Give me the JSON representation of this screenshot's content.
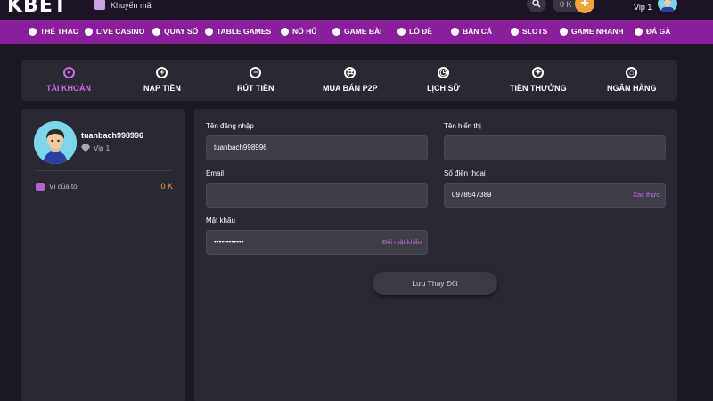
{
  "header": {
    "logo": "KBET",
    "promo_label": "Khuyến mãi",
    "balance": "0 K",
    "plus_label": "+",
    "vip_label": "Vip 1"
  },
  "categories": [
    {
      "label": "THỂ THAO",
      "icon": "soccer-ball-icon"
    },
    {
      "label": "LIVE CASINO",
      "icon": "casino-chip-icon"
    },
    {
      "label": "QUAY SỐ",
      "icon": "lottery-wheel-icon"
    },
    {
      "label": "TABLE GAMES",
      "icon": "table-games-icon"
    },
    {
      "label": "NỔ HŨ",
      "icon": "slot-seven-icon"
    },
    {
      "label": "GAME BÀI",
      "icon": "playing-card-icon"
    },
    {
      "label": "LÔ ĐỀ",
      "icon": "lottery-ticket-icon"
    },
    {
      "label": "BẮN CÁ",
      "icon": "fish-icon"
    },
    {
      "label": "SLOTS",
      "icon": "slots-icon"
    },
    {
      "label": "GAME NHANH",
      "icon": "rocket-icon"
    },
    {
      "label": "ĐÁ GÀ",
      "icon": "rooster-icon"
    }
  ],
  "tabs": [
    {
      "label": "TÀI KHOẢN",
      "icon": "user-icon",
      "glyph": "•",
      "active": true
    },
    {
      "label": "NẠP TIỀN",
      "icon": "plus-circle-icon",
      "glyph": "+",
      "active": false
    },
    {
      "label": "RÚT TIỀN",
      "icon": "minus-circle-icon",
      "glyph": "−",
      "active": false
    },
    {
      "label": "MUA BÁN P2P",
      "icon": "exchange-icon",
      "glyph": "⇄",
      "active": false
    },
    {
      "label": "LỊCH SỬ",
      "icon": "clock-icon",
      "glyph": "◷",
      "active": false
    },
    {
      "label": "TIỀN THƯỞNG",
      "icon": "gift-icon",
      "glyph": "✦",
      "active": false
    },
    {
      "label": "NGÂN HÀNG",
      "icon": "bank-icon",
      "glyph": "⌂",
      "active": false
    }
  ],
  "profile": {
    "username": "tuanbach998996",
    "vip": "Vip 1",
    "wallet_label": "Ví của tôi",
    "wallet_value": "0 K"
  },
  "form": {
    "username_label": "Tên đăng nhập",
    "username_value": "tuanbach998996",
    "display_name_label": "Tên hiển thị",
    "display_name_value": "",
    "email_label": "Email",
    "email_value": "",
    "phone_label": "Số điện thoại",
    "phone_value": "0978547389",
    "phone_action": "Xác thực",
    "password_label": "Mật khẩu",
    "password_value": "••••••••••••",
    "password_action": "Đổi mật khẩu",
    "save_label": "Lưu Thay Đổi"
  }
}
